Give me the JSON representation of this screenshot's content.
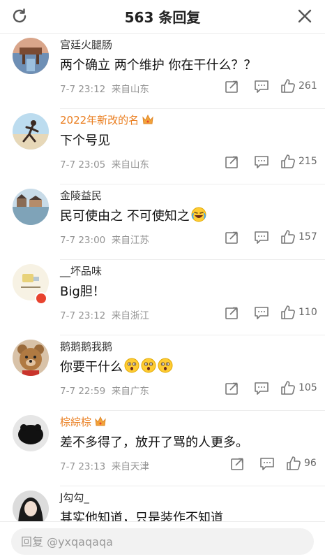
{
  "header": {
    "title": "563 条回复"
  },
  "comments": [
    {
      "name": "宫廷火腿肠",
      "vip": false,
      "text": "两个确立 两个维护 你在干什么？？",
      "time": "7-7 23:12",
      "location": "来自山东",
      "likes": "261"
    },
    {
      "name": "2022年新改的名",
      "vip": true,
      "text": "下个号见",
      "time": "7-7 23:05",
      "location": "来自山东",
      "likes": "215"
    },
    {
      "name": "金陵益民",
      "vip": false,
      "text": "民可使由之 不可使知之",
      "time": "7-7 23:00",
      "location": "来自江苏",
      "likes": "157"
    },
    {
      "name": "__坏品味",
      "vip": false,
      "text": "Big胆！",
      "time": "7-7 23:12",
      "location": "来自浙江",
      "likes": "110"
    },
    {
      "name": "鹅鹅鹅我鹅",
      "vip": false,
      "text": "你要干什么",
      "time": "7-7 22:59",
      "location": "来自广东",
      "likes": "105"
    },
    {
      "name": "棕綜棕",
      "vip": true,
      "text": "差不多得了，放开了骂的人更多。",
      "time": "7-7 23:13",
      "location": "来自天津",
      "likes": "96"
    },
    {
      "name": "J勾勾_",
      "vip": false,
      "text": "其实他知道，只是装作不知道",
      "time": "",
      "location": "",
      "likes": ""
    }
  ],
  "reply_input": {
    "placeholder": "回复 @yxqaqaqa"
  },
  "colors": {
    "vip_name": "#ea7d1e",
    "meta": "#939393",
    "divider": "#ededed"
  },
  "icons": [
    "refresh-icon",
    "close-icon",
    "share-icon",
    "reply-icon",
    "like-icon",
    "crown-icon",
    "laugh-cry-emoji",
    "shocked-emoji"
  ]
}
